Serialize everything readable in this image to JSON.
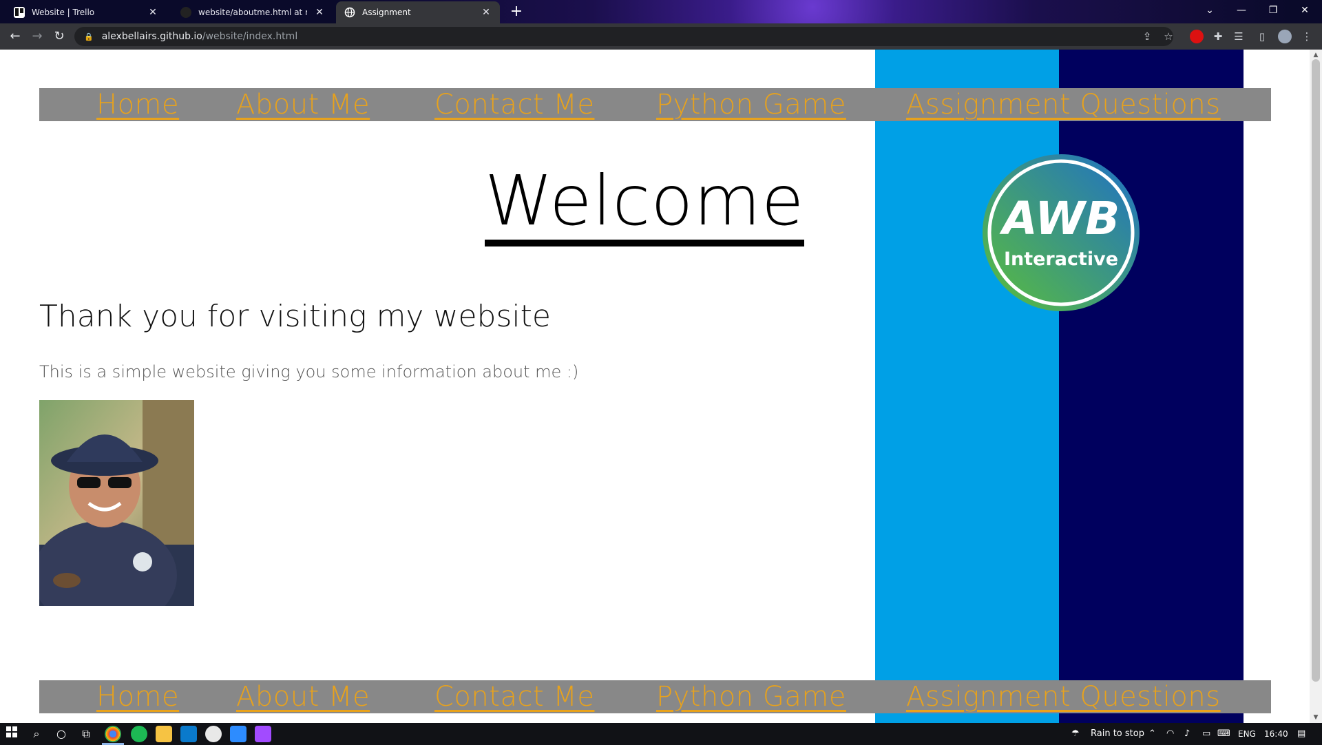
{
  "browser": {
    "tabs": [
      {
        "title": "Website | Trello",
        "icon": "trello-icon",
        "active": false
      },
      {
        "title": "website/aboutme.html at main ·",
        "icon": "github-icon",
        "active": false
      },
      {
        "title": "Assignment",
        "icon": "globe-icon",
        "active": true
      }
    ],
    "url_host": "alexbellairs.github.io",
    "url_path": "/website/index.html"
  },
  "page": {
    "nav_top": [
      "Home",
      "About Me",
      "Contact Me",
      "Python Game",
      "Assignment Questions"
    ],
    "nav_bottom": [
      "Home",
      "About Me",
      "Contact Me",
      "Python Game",
      "Assignment Questions"
    ],
    "heading": "Welcome",
    "subheading": "Thank you for visiting my website",
    "paragraph": "This is a simple website giving you some information about me :)",
    "logo": {
      "line1": "AWB",
      "line2": "Interactive"
    },
    "colors": {
      "nav_bg": "#888888",
      "nav_link": "#e8a21c",
      "stripe_light": "#00a0e6",
      "stripe_dark": "#00005e"
    }
  },
  "taskbar": {
    "weather": "Rain to stop",
    "language": "ENG",
    "time": "16:40"
  }
}
